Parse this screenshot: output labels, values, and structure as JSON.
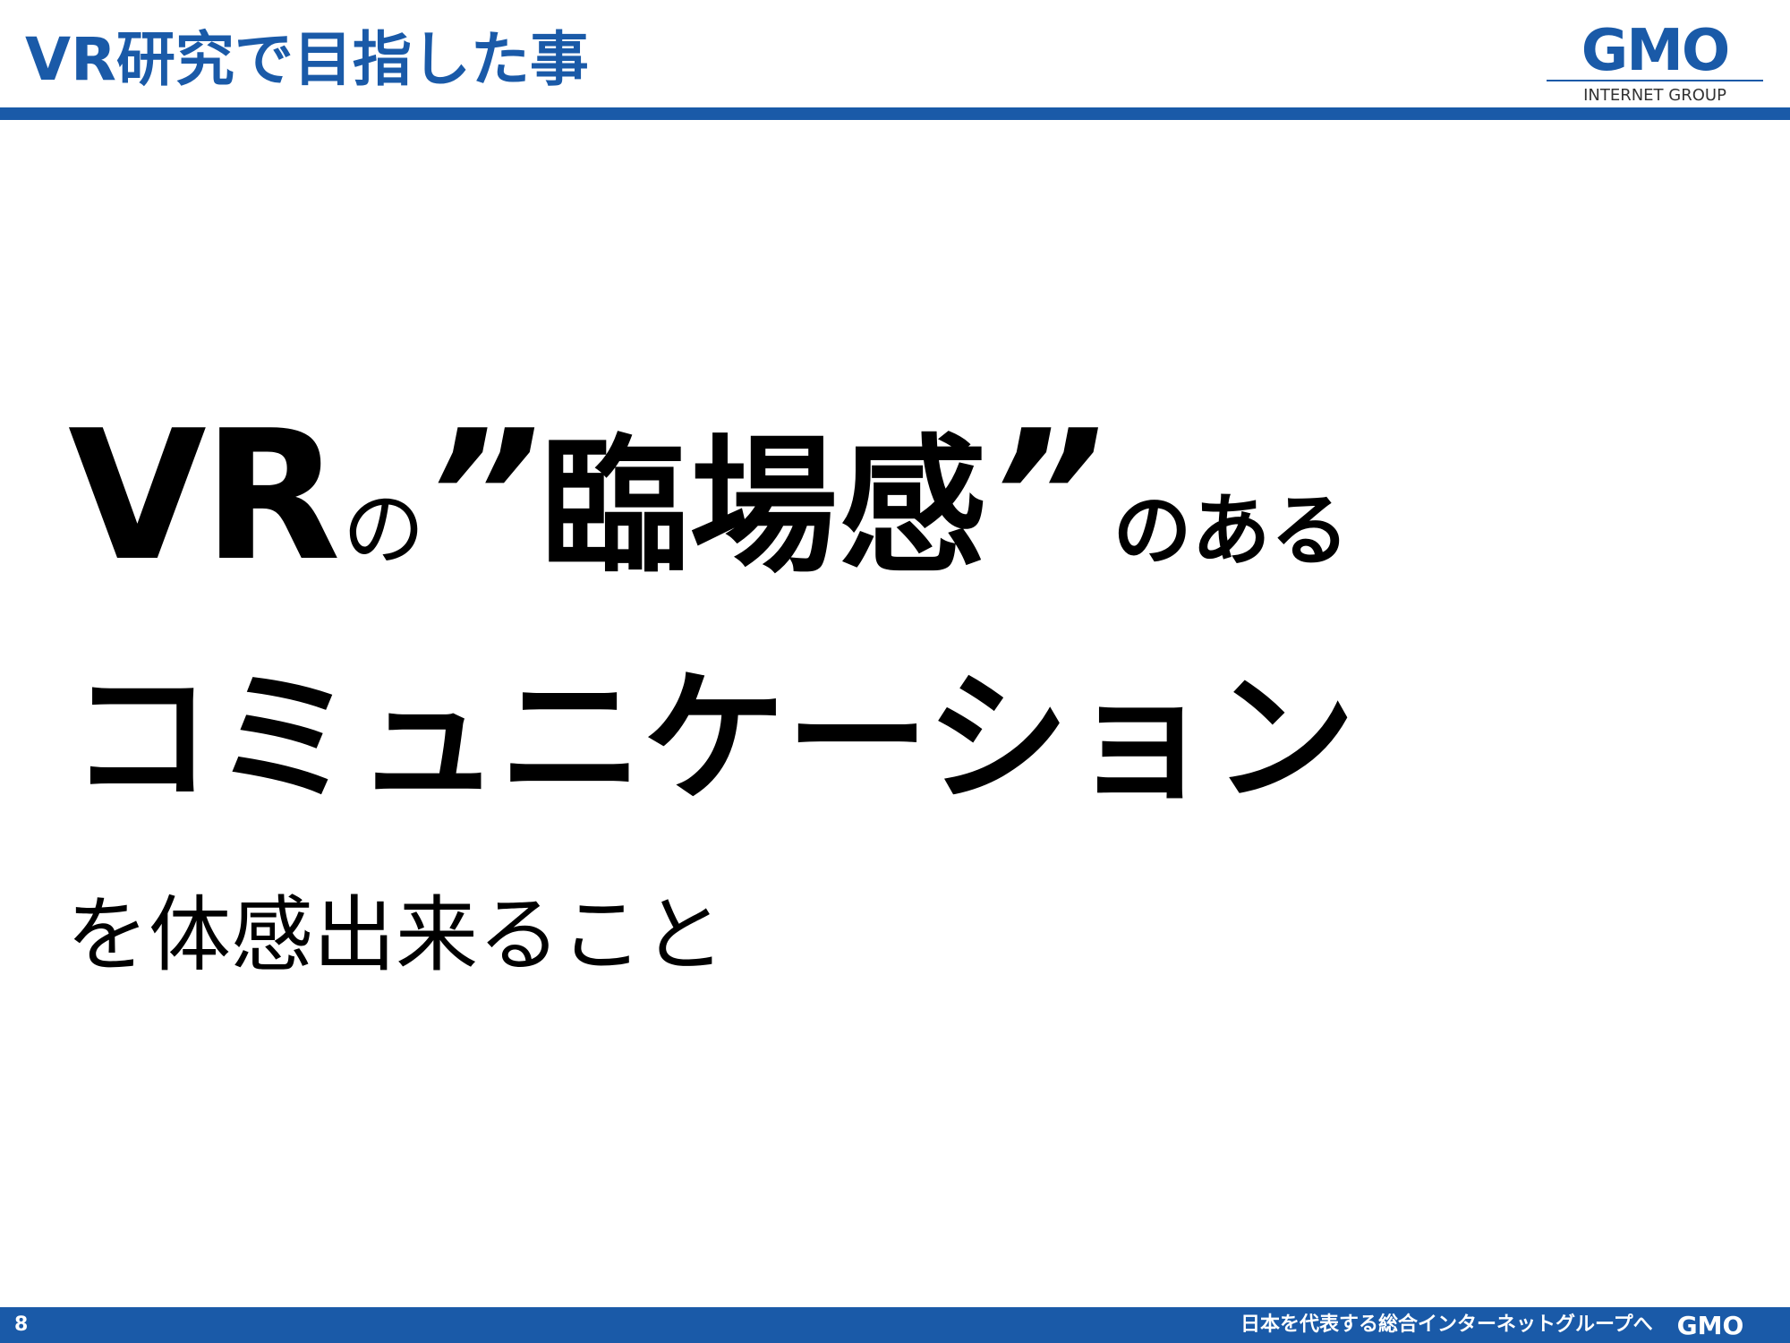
{
  "header": {
    "title": "VR研究で目指した事",
    "logo": {
      "wordmark": "GMO",
      "subtitle": "INTERNET GROUP",
      "icon": "gmo-logo"
    }
  },
  "main": {
    "line1": {
      "big_text": "VR",
      "particle": "の",
      "open_quote": "”",
      "emphasis": "臨場感",
      "close_quote": "”",
      "tail": "のある"
    },
    "line2": "コミュニケーション",
    "line3": "を体感出来ること"
  },
  "footer": {
    "page_number": "8",
    "slogan": "日本を代表する総合インターネットグループへ",
    "logo_wordmark": "GMO"
  },
  "colors": {
    "accent": "#1a5aa8",
    "text": "#000000",
    "background": "#ffffff"
  }
}
